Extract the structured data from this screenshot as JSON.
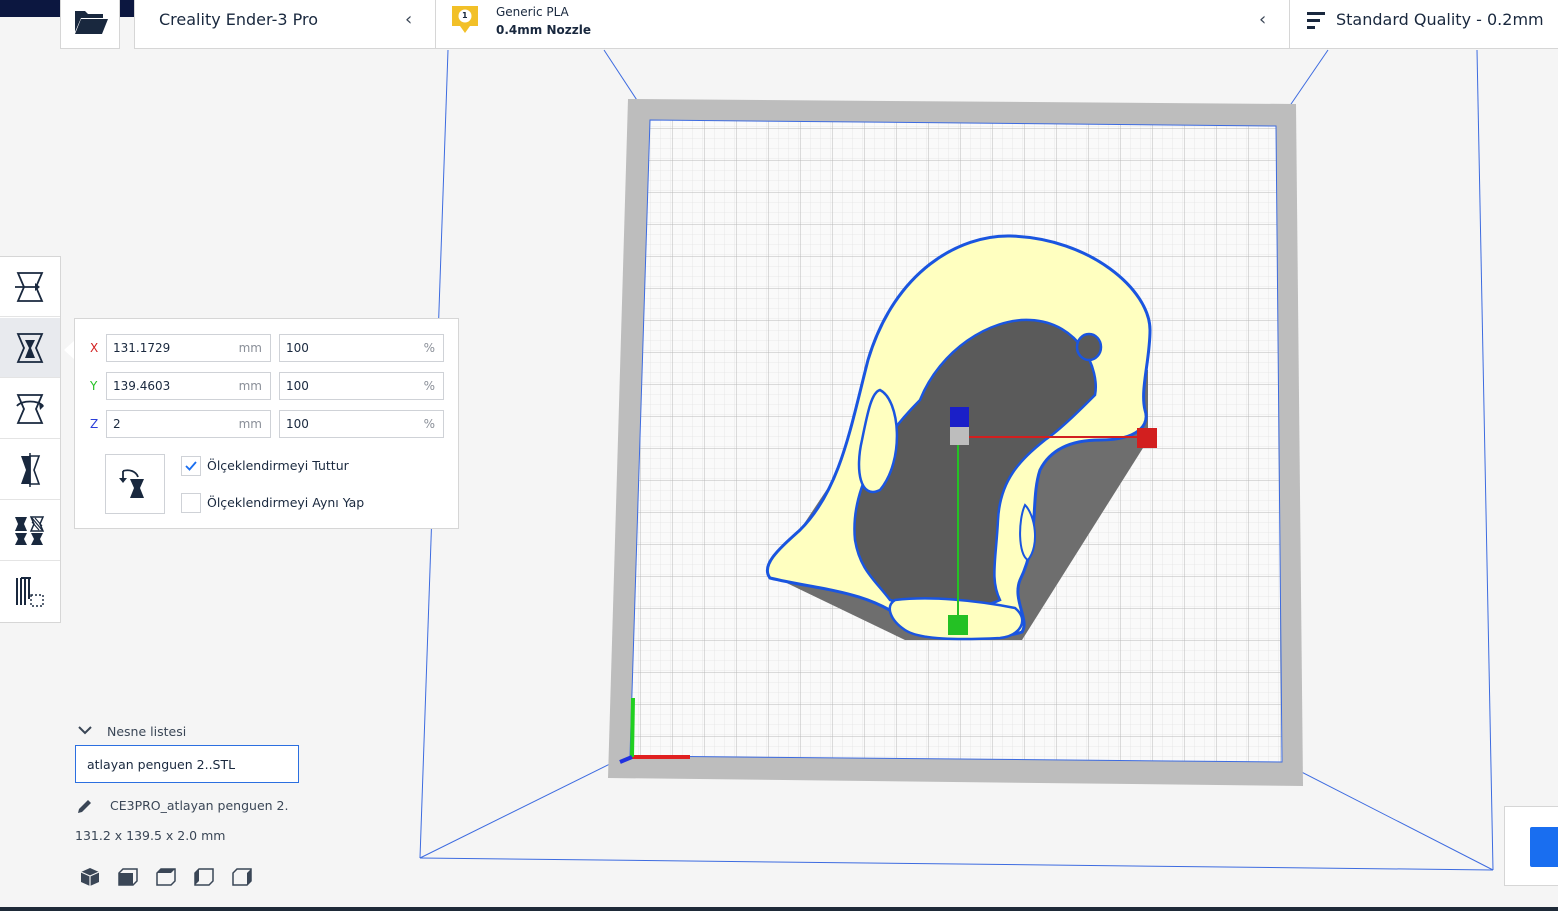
{
  "header": {
    "printer_name": "Creality Ender-3 Pro",
    "material_badge": "1",
    "material_name": "Generic PLA",
    "nozzle": "0.4mm Nozzle",
    "quality": "Standard Quality - 0.2mm"
  },
  "toolbar": {
    "tools": [
      "move-tool",
      "scale-tool",
      "rotate-tool",
      "mirror-tool",
      "per-model-settings-tool",
      "support-blocker-tool"
    ],
    "active": "scale-tool"
  },
  "scale": {
    "x": {
      "axis": "X",
      "mm": "131.1729",
      "mm_unit": "mm",
      "pct": "100",
      "pct_unit": "%",
      "color": "#d21f1f"
    },
    "y": {
      "axis": "Y",
      "mm": "139.4603",
      "mm_unit": "mm",
      "pct": "100",
      "pct_unit": "%",
      "color": "#24c124"
    },
    "z": {
      "axis": "Z",
      "mm": "2",
      "mm_unit": "mm",
      "pct": "100",
      "pct_unit": "%",
      "color": "#2b3ed9"
    },
    "keep_proportions": {
      "label": "Ölçeklendirmeyi Tuttur",
      "checked": true
    },
    "uniform": {
      "label": "Ölçeklendirmeyi Aynı Yap",
      "checked": false
    }
  },
  "object_list": {
    "title": "Nesne listesi",
    "items": [
      "atlayan penguen 2..STL"
    ],
    "job_name": "CE3PRO_atlayan penguen 2.",
    "dimensions": "131.2 x 139.5 x 2.0 mm"
  },
  "view_buttons": [
    "3d-view",
    "front-view",
    "top-view",
    "left-view",
    "right-view"
  ],
  "colors": {
    "accent": "#196ef0",
    "model_fill": "#ffffc0",
    "model_outline": "#1a55e0",
    "shadow": "#6e6e6e",
    "buildplate_frame": "#bdbdbd"
  }
}
